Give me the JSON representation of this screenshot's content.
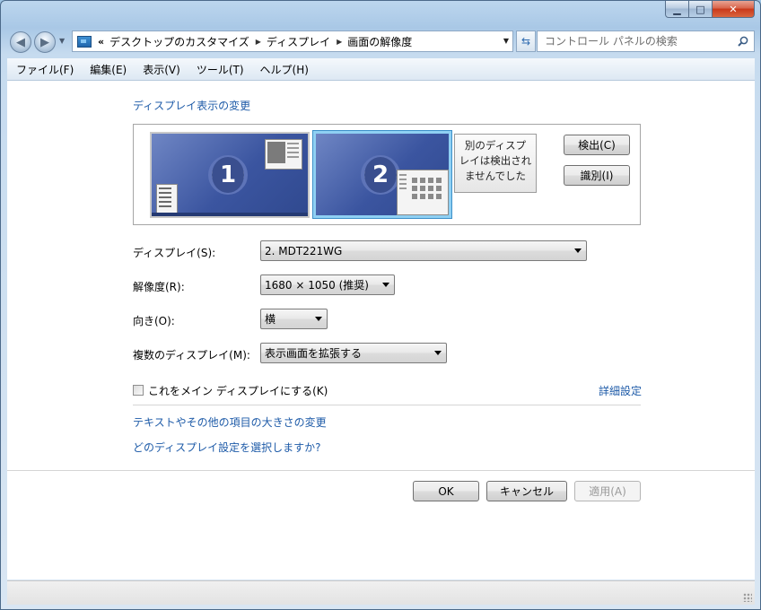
{
  "window": {
    "caption_minimize": "▁",
    "caption_maximize": "□",
    "caption_close": "✕"
  },
  "nav": {
    "breadcrumb_prefix": "«",
    "breadcrumbs": [
      "デスクトップのカスタマイズ",
      "ディスプレイ",
      "画面の解像度"
    ],
    "search_placeholder": "コントロール パネルの検索"
  },
  "menu": [
    "ファイル(F)",
    "編集(E)",
    "表示(V)",
    "ツール(T)",
    "ヘルプ(H)"
  ],
  "main": {
    "heading": "ディスプレイ表示の変更",
    "monitors": [
      {
        "number": "1"
      },
      {
        "number": "2"
      }
    ],
    "undetected_text": [
      "別のディスプ",
      "レイは検出され",
      "ませんでした"
    ],
    "detect_button": "検出(C)",
    "identify_button": "識別(I)",
    "display_label": "ディスプレイ(S):",
    "display_value": "2. MDT221WG",
    "resolution_label": "解像度(R):",
    "resolution_value": "1680 × 1050 (推奨)",
    "orientation_label": "向き(O):",
    "orientation_value": "横",
    "multiple_label": "複数のディスプレイ(M):",
    "multiple_value": "表示画面を拡張する",
    "main_display_checkbox": "これをメイン ディスプレイにする(K)",
    "main_display_checked": false,
    "advanced_link": "詳細設定",
    "text_size_link": "テキストやその他の項目の大きさの変更",
    "which_settings_link": "どのディスプレイ設定を選択しますか?"
  },
  "buttons": {
    "ok": "OK",
    "cancel": "キャンセル",
    "apply": "適用(A)"
  },
  "colors": {
    "link": "#1e5ba8",
    "monitor_fill": "#3b55a0",
    "selected_border": "#8fd0f3"
  }
}
